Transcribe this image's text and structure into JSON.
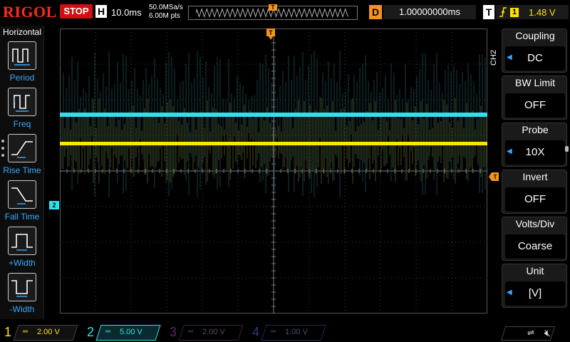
{
  "brand": "RIGOL",
  "run_state": "STOP",
  "timebase": {
    "badge": "H",
    "value": "10.0ms",
    "sample_rate": "50.0MSa/s",
    "memory_points": "6.00M pts"
  },
  "delay": {
    "badge": "D",
    "value": "1.00000000ms"
  },
  "trigger": {
    "badge": "T",
    "source_badge": "1",
    "level": "1.48 V",
    "edge_icon": "rising-edge-icon",
    "marker_label": "T"
  },
  "left_menu": {
    "title": "Horizontal",
    "items": [
      {
        "label": "Period",
        "icon": "period-icon"
      },
      {
        "label": "Freq",
        "icon": "freq-icon"
      },
      {
        "label": "Rise Time",
        "icon": "rise-time-icon"
      },
      {
        "label": "Fall Time",
        "icon": "fall-time-icon"
      },
      {
        "label": "+Width",
        "icon": "pos-width-icon"
      },
      {
        "label": "-Width",
        "icon": "neg-width-icon"
      }
    ]
  },
  "right_menu": {
    "channel_label": "CH2",
    "items": [
      {
        "label": "Coupling",
        "value": "DC",
        "has_arrow": true
      },
      {
        "label": "BW Limit",
        "value": "OFF",
        "has_arrow": false
      },
      {
        "label": "Probe",
        "value": "10X",
        "has_arrow": true
      },
      {
        "label": "Invert",
        "value": "OFF",
        "has_arrow": false
      },
      {
        "label": "Volts/Div",
        "value": "Coarse",
        "has_arrow": false
      },
      {
        "label": "Unit",
        "value": "[V]",
        "has_arrow": true
      }
    ]
  },
  "channels": [
    {
      "num": "1",
      "scale": "2.00 V",
      "color": "#ffe600",
      "active": true
    },
    {
      "num": "2",
      "scale": "5.00 V",
      "color": "#2ee0f0",
      "active": true
    },
    {
      "num": "3",
      "scale": "2.00 V",
      "color": "#c21bd8",
      "active": false
    },
    {
      "num": "4",
      "scale": "1.00 V",
      "color": "#2b4dd9",
      "active": false
    }
  ],
  "ch2_ground_marker": "2",
  "colors": {
    "ch1": "#ffe600",
    "ch2": "#2ee0f0",
    "trigger": "#f7941d",
    "menu_accent": "#38a9ff",
    "stop": "#d01010"
  },
  "status_icons": [
    "usb-icon",
    "speaker-muted-icon"
  ]
}
